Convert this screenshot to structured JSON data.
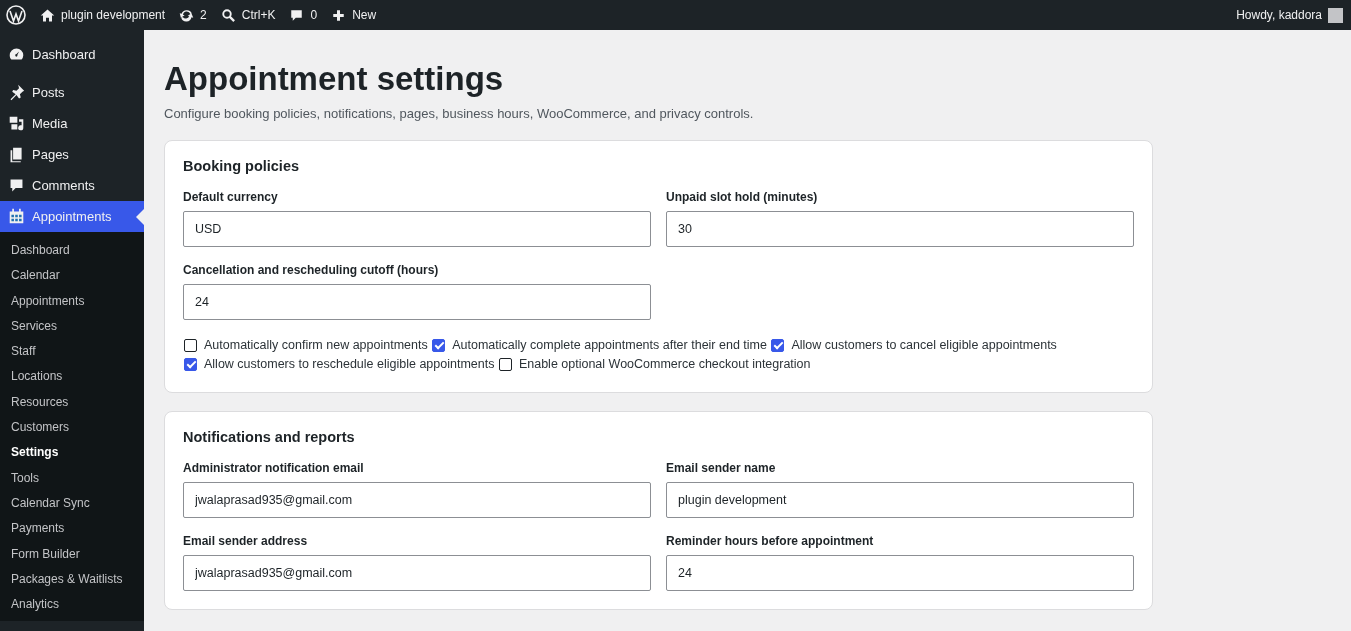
{
  "admin_bar": {
    "site_name": "plugin development",
    "updates_count": "2",
    "search_shortcut": "Ctrl+K",
    "comments_count": "0",
    "new_label": "New",
    "greeting": "Howdy, kaddora"
  },
  "sidebar": {
    "items": [
      {
        "label": "Dashboard",
        "selected": false
      },
      {
        "label": "Posts",
        "selected": false
      },
      {
        "label": "Media",
        "selected": false
      },
      {
        "label": "Pages",
        "selected": false
      },
      {
        "label": "Comments",
        "selected": false
      },
      {
        "label": "Appointments",
        "selected": true
      }
    ],
    "submenu": [
      {
        "label": "Dashboard",
        "selected": false
      },
      {
        "label": "Calendar",
        "selected": false
      },
      {
        "label": "Appointments",
        "selected": false
      },
      {
        "label": "Services",
        "selected": false
      },
      {
        "label": "Staff",
        "selected": false
      },
      {
        "label": "Locations",
        "selected": false
      },
      {
        "label": "Resources",
        "selected": false
      },
      {
        "label": "Customers",
        "selected": false
      },
      {
        "label": "Settings",
        "selected": true
      },
      {
        "label": "Tools",
        "selected": false
      },
      {
        "label": "Calendar Sync",
        "selected": false
      },
      {
        "label": "Payments",
        "selected": false
      },
      {
        "label": "Form Builder",
        "selected": false
      },
      {
        "label": "Packages & Waitlists",
        "selected": false
      },
      {
        "label": "Analytics",
        "selected": false
      }
    ]
  },
  "page": {
    "title": "Appointment settings",
    "description": "Configure booking policies, notifications, pages, business hours, WooCommerce, and privacy controls."
  },
  "sections": [
    {
      "title": "Booking policies",
      "fields": [
        {
          "label": "Default currency",
          "value": "USD"
        },
        {
          "label": "Unpaid slot hold (minutes)",
          "value": "30"
        },
        {
          "label": "Cancellation and rescheduling cutoff (hours)",
          "value": "24"
        }
      ],
      "checkboxes": [
        {
          "label": "Automatically confirm new appointments",
          "checked": false
        },
        {
          "label": "Automatically complete appointments after their end time",
          "checked": true
        },
        {
          "label": "Allow customers to cancel eligible appointments",
          "checked": true
        },
        {
          "label": "Allow customers to reschedule eligible appointments",
          "checked": true
        },
        {
          "label": "Enable optional WooCommerce checkout integration",
          "checked": false
        }
      ]
    },
    {
      "title": "Notifications and reports",
      "fields": [
        {
          "label": "Administrator notification email",
          "value": "jwalaprasad935@gmail.com"
        },
        {
          "label": "Email sender name",
          "value": "plugin development"
        },
        {
          "label": "Email sender address",
          "value": "jwalaprasad935@gmail.com"
        },
        {
          "label": "Reminder hours before appointment",
          "value": "24"
        }
      ]
    }
  ]
}
